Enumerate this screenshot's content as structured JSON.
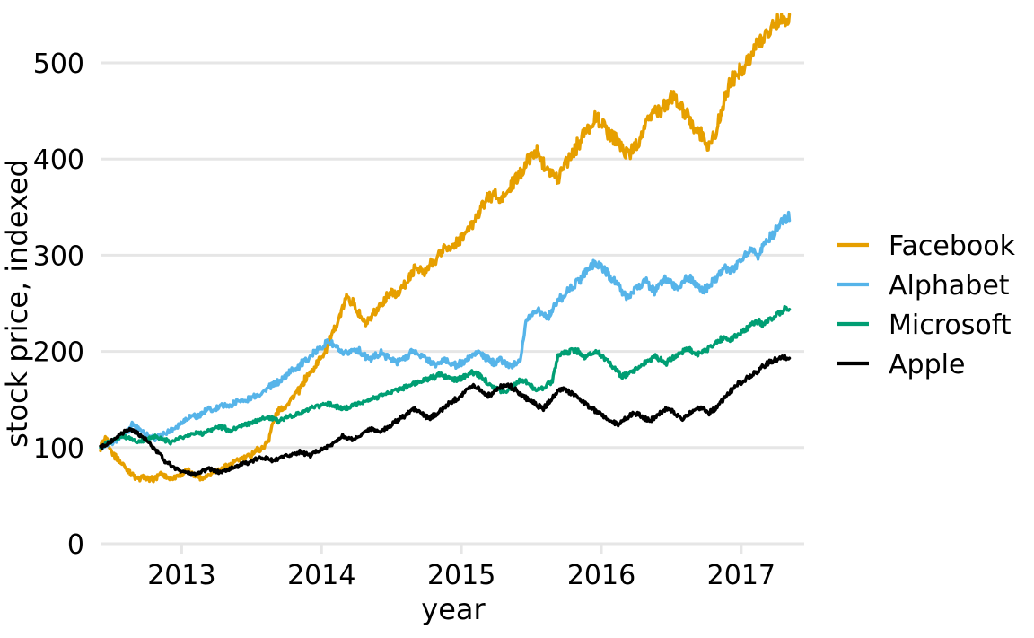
{
  "chart_data": {
    "type": "line",
    "title": "",
    "xlabel": "year",
    "ylabel": "stock price, indexed",
    "xlim": [
      2012.42,
      2017.45
    ],
    "ylim": [
      0,
      560
    ],
    "grid": true,
    "legend_position": "right",
    "x_ticks": [
      "2013",
      "2014",
      "2015",
      "2016",
      "2017"
    ],
    "x_tick_values": [
      2013,
      2014,
      2015,
      2016,
      2017
    ],
    "y_ticks": [
      "0",
      "100",
      "200",
      "300",
      "400",
      "500"
    ],
    "y_tick_values": [
      0,
      100,
      200,
      300,
      400,
      500
    ],
    "colors": {
      "facebook": "#E69F00",
      "alphabet": "#56B4E9",
      "microsoft": "#009E73",
      "apple": "#000000",
      "gridline": "#E6E6E6",
      "text": "#000000",
      "background": "#FFFFFF"
    },
    "series": [
      {
        "name": "Facebook",
        "color": "#E69F00",
        "x": [
          2012.42,
          2012.46,
          2012.5,
          2012.54,
          2012.58,
          2012.62,
          2012.65,
          2012.69,
          2012.73,
          2012.77,
          2012.81,
          2012.85,
          2012.88,
          2012.92,
          2012.96,
          2013.0,
          2013.04,
          2013.08,
          2013.12,
          2013.15,
          2013.19,
          2013.23,
          2013.27,
          2013.31,
          2013.35,
          2013.38,
          2013.42,
          2013.46,
          2013.5,
          2013.54,
          2013.58,
          2013.62,
          2013.65,
          2013.69,
          2013.73,
          2013.77,
          2013.81,
          2013.85,
          2013.88,
          2013.92,
          2013.96,
          2014.0,
          2014.04,
          2014.08,
          2014.12,
          2014.15,
          2014.19,
          2014.23,
          2014.27,
          2014.31,
          2014.35,
          2014.38,
          2014.42,
          2014.46,
          2014.5,
          2014.54,
          2014.58,
          2014.62,
          2014.65,
          2014.69,
          2014.73,
          2014.77,
          2014.81,
          2014.85,
          2014.88,
          2014.92,
          2014.96,
          2015.0,
          2015.04,
          2015.08,
          2015.12,
          2015.15,
          2015.19,
          2015.23,
          2015.27,
          2015.31,
          2015.35,
          2015.38,
          2015.42,
          2015.46,
          2015.5,
          2015.54,
          2015.58,
          2015.62,
          2015.65,
          2015.69,
          2015.73,
          2015.77,
          2015.81,
          2015.85,
          2015.88,
          2015.92,
          2015.96,
          2016.0,
          2016.04,
          2016.08,
          2016.12,
          2016.15,
          2016.19,
          2016.23,
          2016.27,
          2016.31,
          2016.35,
          2016.38,
          2016.42,
          2016.46,
          2016.5,
          2016.54,
          2016.58,
          2016.62,
          2016.65,
          2016.69,
          2016.73,
          2016.77,
          2016.81,
          2016.85,
          2016.88,
          2016.92,
          2016.96,
          2017.0,
          2017.04,
          2017.08,
          2017.12,
          2017.15,
          2017.19,
          2017.23,
          2017.27,
          2017.31,
          2017.35,
          2017.38,
          2017.42
        ],
        "y": [
          100,
          112,
          96,
          88,
          82,
          76,
          71,
          67,
          70,
          66,
          68,
          73,
          71,
          68,
          70,
          73,
          76,
          72,
          70,
          68,
          72,
          75,
          78,
          80,
          83,
          85,
          88,
          90,
          93,
          98,
          100,
          108,
          124,
          138,
          142,
          148,
          155,
          162,
          170,
          178,
          186,
          195,
          205,
          218,
          232,
          245,
          258,
          248,
          238,
          228,
          232,
          240,
          248,
          255,
          262,
          258,
          268,
          275,
          282,
          288,
          280,
          288,
          295,
          302,
          310,
          305,
          312,
          318,
          325,
          332,
          345,
          352,
          358,
          365,
          355,
          362,
          370,
          378,
          385,
          395,
          402,
          408,
          398,
          392,
          385,
          378,
          395,
          402,
          410,
          420,
          428,
          435,
          442,
          438,
          430,
          425,
          418,
          412,
          405,
          412,
          420,
          432,
          445,
          452,
          448,
          455,
          465,
          460,
          450,
          442,
          435,
          428,
          422,
          415,
          425,
          445,
          462,
          478,
          488,
          495,
          502,
          510,
          518,
          525,
          532,
          538,
          545,
          548,
          542
        ],
        "start_value": 100,
        "end_value": 545
      },
      {
        "name": "Alphabet",
        "color": "#56B4E9",
        "x": [
          2012.42,
          2012.46,
          2012.5,
          2012.54,
          2012.58,
          2012.62,
          2012.65,
          2012.69,
          2012.73,
          2012.77,
          2012.81,
          2012.85,
          2012.88,
          2012.92,
          2012.96,
          2013.0,
          2013.04,
          2013.08,
          2013.12,
          2013.15,
          2013.19,
          2013.23,
          2013.27,
          2013.31,
          2013.35,
          2013.38,
          2013.42,
          2013.46,
          2013.5,
          2013.54,
          2013.58,
          2013.62,
          2013.65,
          2013.69,
          2013.73,
          2013.77,
          2013.81,
          2013.85,
          2013.88,
          2013.92,
          2013.96,
          2014.0,
          2014.04,
          2014.08,
          2014.12,
          2014.15,
          2014.19,
          2014.23,
          2014.27,
          2014.31,
          2014.35,
          2014.38,
          2014.42,
          2014.46,
          2014.5,
          2014.54,
          2014.58,
          2014.62,
          2014.65,
          2014.69,
          2014.73,
          2014.77,
          2014.81,
          2014.85,
          2014.88,
          2014.92,
          2014.96,
          2015.0,
          2015.04,
          2015.08,
          2015.12,
          2015.15,
          2015.19,
          2015.23,
          2015.27,
          2015.31,
          2015.35,
          2015.38,
          2015.42,
          2015.46,
          2015.5,
          2015.54,
          2015.58,
          2015.62,
          2015.65,
          2015.69,
          2015.73,
          2015.77,
          2015.81,
          2015.85,
          2015.88,
          2015.92,
          2015.96,
          2016.0,
          2016.04,
          2016.08,
          2016.12,
          2016.15,
          2016.19,
          2016.23,
          2016.27,
          2016.31,
          2016.35,
          2016.38,
          2016.42,
          2016.46,
          2016.5,
          2016.54,
          2016.58,
          2016.62,
          2016.65,
          2016.69,
          2016.73,
          2016.77,
          2016.81,
          2016.85,
          2016.88,
          2016.92,
          2016.96,
          2017.0,
          2017.04,
          2017.08,
          2017.12,
          2017.15,
          2017.19,
          2017.23,
          2017.27,
          2017.31,
          2017.35,
          2017.38,
          2017.42
        ],
        "y": [
          100,
          102,
          105,
          108,
          112,
          118,
          124,
          120,
          116,
          112,
          110,
          112,
          115,
          118,
          122,
          126,
          130,
          134,
          132,
          136,
          140,
          138,
          142,
          145,
          143,
          147,
          150,
          148,
          152,
          155,
          158,
          162,
          165,
          168,
          172,
          178,
          182,
          186,
          190,
          195,
          200,
          205,
          210,
          208,
          202,
          196,
          198,
          202,
          200,
          196,
          192,
          195,
          198,
          196,
          192,
          188,
          192,
          196,
          200,
          198,
          194,
          190,
          186,
          188,
          192,
          188,
          185,
          188,
          192,
          196,
          200,
          196,
          192,
          188,
          192,
          188,
          185,
          188,
          192,
          230,
          238,
          244,
          240,
          236,
          244,
          252,
          258,
          264,
          270,
          276,
          282,
          288,
          292,
          288,
          282,
          276,
          268,
          262,
          256,
          262,
          268,
          274,
          268,
          262,
          270,
          276,
          272,
          266,
          272,
          278,
          274,
          268,
          262,
          268,
          275,
          282,
          288,
          282,
          290,
          296,
          302,
          308,
          300,
          308,
          316,
          322,
          330,
          338,
          340
        ],
        "start_value": 100,
        "end_value": 340
      },
      {
        "name": "Microsoft",
        "color": "#009E73",
        "x": [
          2012.42,
          2012.46,
          2012.5,
          2012.54,
          2012.58,
          2012.62,
          2012.65,
          2012.69,
          2012.73,
          2012.77,
          2012.81,
          2012.85,
          2012.88,
          2012.92,
          2012.96,
          2013.0,
          2013.04,
          2013.08,
          2013.12,
          2013.15,
          2013.19,
          2013.23,
          2013.27,
          2013.31,
          2013.35,
          2013.38,
          2013.42,
          2013.46,
          2013.5,
          2013.54,
          2013.58,
          2013.62,
          2013.65,
          2013.69,
          2013.73,
          2013.77,
          2013.81,
          2013.85,
          2013.88,
          2013.92,
          2013.96,
          2014.0,
          2014.04,
          2014.08,
          2014.12,
          2014.15,
          2014.19,
          2014.23,
          2014.27,
          2014.31,
          2014.35,
          2014.38,
          2014.42,
          2014.46,
          2014.5,
          2014.54,
          2014.58,
          2014.62,
          2014.65,
          2014.69,
          2014.73,
          2014.77,
          2014.81,
          2014.85,
          2014.88,
          2014.92,
          2014.96,
          2015.0,
          2015.04,
          2015.08,
          2015.12,
          2015.15,
          2015.19,
          2015.23,
          2015.27,
          2015.31,
          2015.35,
          2015.38,
          2015.42,
          2015.46,
          2015.5,
          2015.54,
          2015.58,
          2015.62,
          2015.65,
          2015.69,
          2015.73,
          2015.77,
          2015.81,
          2015.85,
          2015.88,
          2015.92,
          2015.96,
          2016.0,
          2016.04,
          2016.08,
          2016.12,
          2016.15,
          2016.19,
          2016.23,
          2016.27,
          2016.31,
          2016.35,
          2016.38,
          2016.42,
          2016.46,
          2016.5,
          2016.54,
          2016.58,
          2016.62,
          2016.65,
          2016.69,
          2016.73,
          2016.77,
          2016.81,
          2016.85,
          2016.88,
          2016.92,
          2016.96,
          2017.0,
          2017.04,
          2017.08,
          2017.12,
          2017.15,
          2017.19,
          2017.23,
          2017.27,
          2017.31,
          2017.35,
          2017.38,
          2017.42
        ],
        "y": [
          100,
          104,
          107,
          110,
          112,
          110,
          108,
          106,
          108,
          110,
          112,
          110,
          108,
          106,
          108,
          110,
          112,
          114,
          116,
          114,
          118,
          120,
          122,
          120,
          118,
          120,
          122,
          124,
          126,
          128,
          130,
          132,
          130,
          128,
          130,
          132,
          134,
          136,
          138,
          140,
          142,
          144,
          146,
          144,
          142,
          140,
          142,
          144,
          146,
          148,
          150,
          152,
          154,
          156,
          158,
          160,
          162,
          164,
          166,
          168,
          170,
          172,
          174,
          176,
          174,
          172,
          170,
          172,
          176,
          178,
          176,
          172,
          168,
          164,
          160,
          158,
          162,
          166,
          170,
          168,
          164,
          160,
          162,
          166,
          170,
          196,
          198,
          200,
          202,
          198,
          194,
          196,
          200,
          196,
          190,
          184,
          178,
          174,
          176,
          180,
          184,
          188,
          192,
          196,
          192,
          188,
          192,
          196,
          200,
          204,
          200,
          196,
          200,
          204,
          208,
          212,
          216,
          212,
          216,
          220,
          224,
          228,
          232,
          228,
          232,
          236,
          240,
          244,
          246
        ],
        "start_value": 100,
        "end_value": 246
      },
      {
        "name": "Apple",
        "color": "#000000",
        "x": [
          2012.42,
          2012.46,
          2012.5,
          2012.54,
          2012.58,
          2012.62,
          2012.65,
          2012.69,
          2012.73,
          2012.77,
          2012.81,
          2012.85,
          2012.88,
          2012.92,
          2012.96,
          2013.0,
          2013.04,
          2013.08,
          2013.12,
          2013.15,
          2013.19,
          2013.23,
          2013.27,
          2013.31,
          2013.35,
          2013.38,
          2013.42,
          2013.46,
          2013.5,
          2013.54,
          2013.58,
          2013.62,
          2013.65,
          2013.69,
          2013.73,
          2013.77,
          2013.81,
          2013.85,
          2013.88,
          2013.92,
          2013.96,
          2014.0,
          2014.04,
          2014.08,
          2014.12,
          2014.15,
          2014.19,
          2014.23,
          2014.27,
          2014.31,
          2014.35,
          2014.38,
          2014.42,
          2014.46,
          2014.5,
          2014.54,
          2014.58,
          2014.62,
          2014.65,
          2014.69,
          2014.73,
          2014.77,
          2014.81,
          2014.85,
          2014.88,
          2014.92,
          2014.96,
          2015.0,
          2015.04,
          2015.08,
          2015.12,
          2015.15,
          2015.19,
          2015.23,
          2015.27,
          2015.31,
          2015.35,
          2015.38,
          2015.42,
          2015.46,
          2015.5,
          2015.54,
          2015.58,
          2015.62,
          2015.65,
          2015.69,
          2015.73,
          2015.77,
          2015.81,
          2015.85,
          2015.88,
          2015.92,
          2015.96,
          2016.0,
          2016.04,
          2016.08,
          2016.12,
          2016.15,
          2016.19,
          2016.23,
          2016.27,
          2016.31,
          2016.35,
          2016.38,
          2016.42,
          2016.46,
          2016.5,
          2016.54,
          2016.58,
          2016.62,
          2016.65,
          2016.69,
          2016.73,
          2016.77,
          2016.81,
          2016.85,
          2016.88,
          2016.92,
          2016.96,
          2017.0,
          2017.04,
          2017.08,
          2017.12,
          2017.15,
          2017.19,
          2017.23,
          2017.27,
          2017.31,
          2017.35,
          2017.38,
          2017.42
        ],
        "y": [
          100,
          103,
          107,
          112,
          116,
          120,
          118,
          114,
          110,
          104,
          98,
          92,
          86,
          82,
          78,
          76,
          74,
          72,
          74,
          76,
          78,
          76,
          74,
          76,
          78,
          80,
          82,
          84,
          86,
          88,
          90,
          88,
          86,
          88,
          90,
          92,
          94,
          96,
          94,
          92,
          96,
          98,
          100,
          104,
          108,
          112,
          110,
          108,
          112,
          116,
          120,
          118,
          116,
          120,
          124,
          128,
          132,
          136,
          140,
          138,
          134,
          130,
          134,
          138,
          142,
          146,
          150,
          155,
          160,
          165,
          162,
          158,
          154,
          158,
          162,
          166,
          164,
          160,
          156,
          152,
          148,
          144,
          140,
          146,
          152,
          158,
          162,
          158,
          154,
          150,
          146,
          142,
          138,
          134,
          130,
          126,
          124,
          128,
          132,
          136,
          134,
          130,
          128,
          132,
          136,
          140,
          138,
          134,
          130,
          134,
          138,
          142,
          140,
          136,
          140,
          146,
          152,
          158,
          164,
          168,
          172,
          176,
          180,
          184,
          188,
          190,
          192,
          194,
          192
        ],
        "start_value": 100,
        "end_value": 192
      }
    ]
  },
  "axes": {
    "y_label": "stock price, indexed",
    "x_label": "year"
  },
  "legend": {
    "items": [
      {
        "label": "Facebook",
        "color": "#E69F00"
      },
      {
        "label": "Alphabet",
        "color": "#56B4E9"
      },
      {
        "label": "Microsoft",
        "color": "#009E73"
      },
      {
        "label": "Apple",
        "color": "#000000"
      }
    ]
  }
}
